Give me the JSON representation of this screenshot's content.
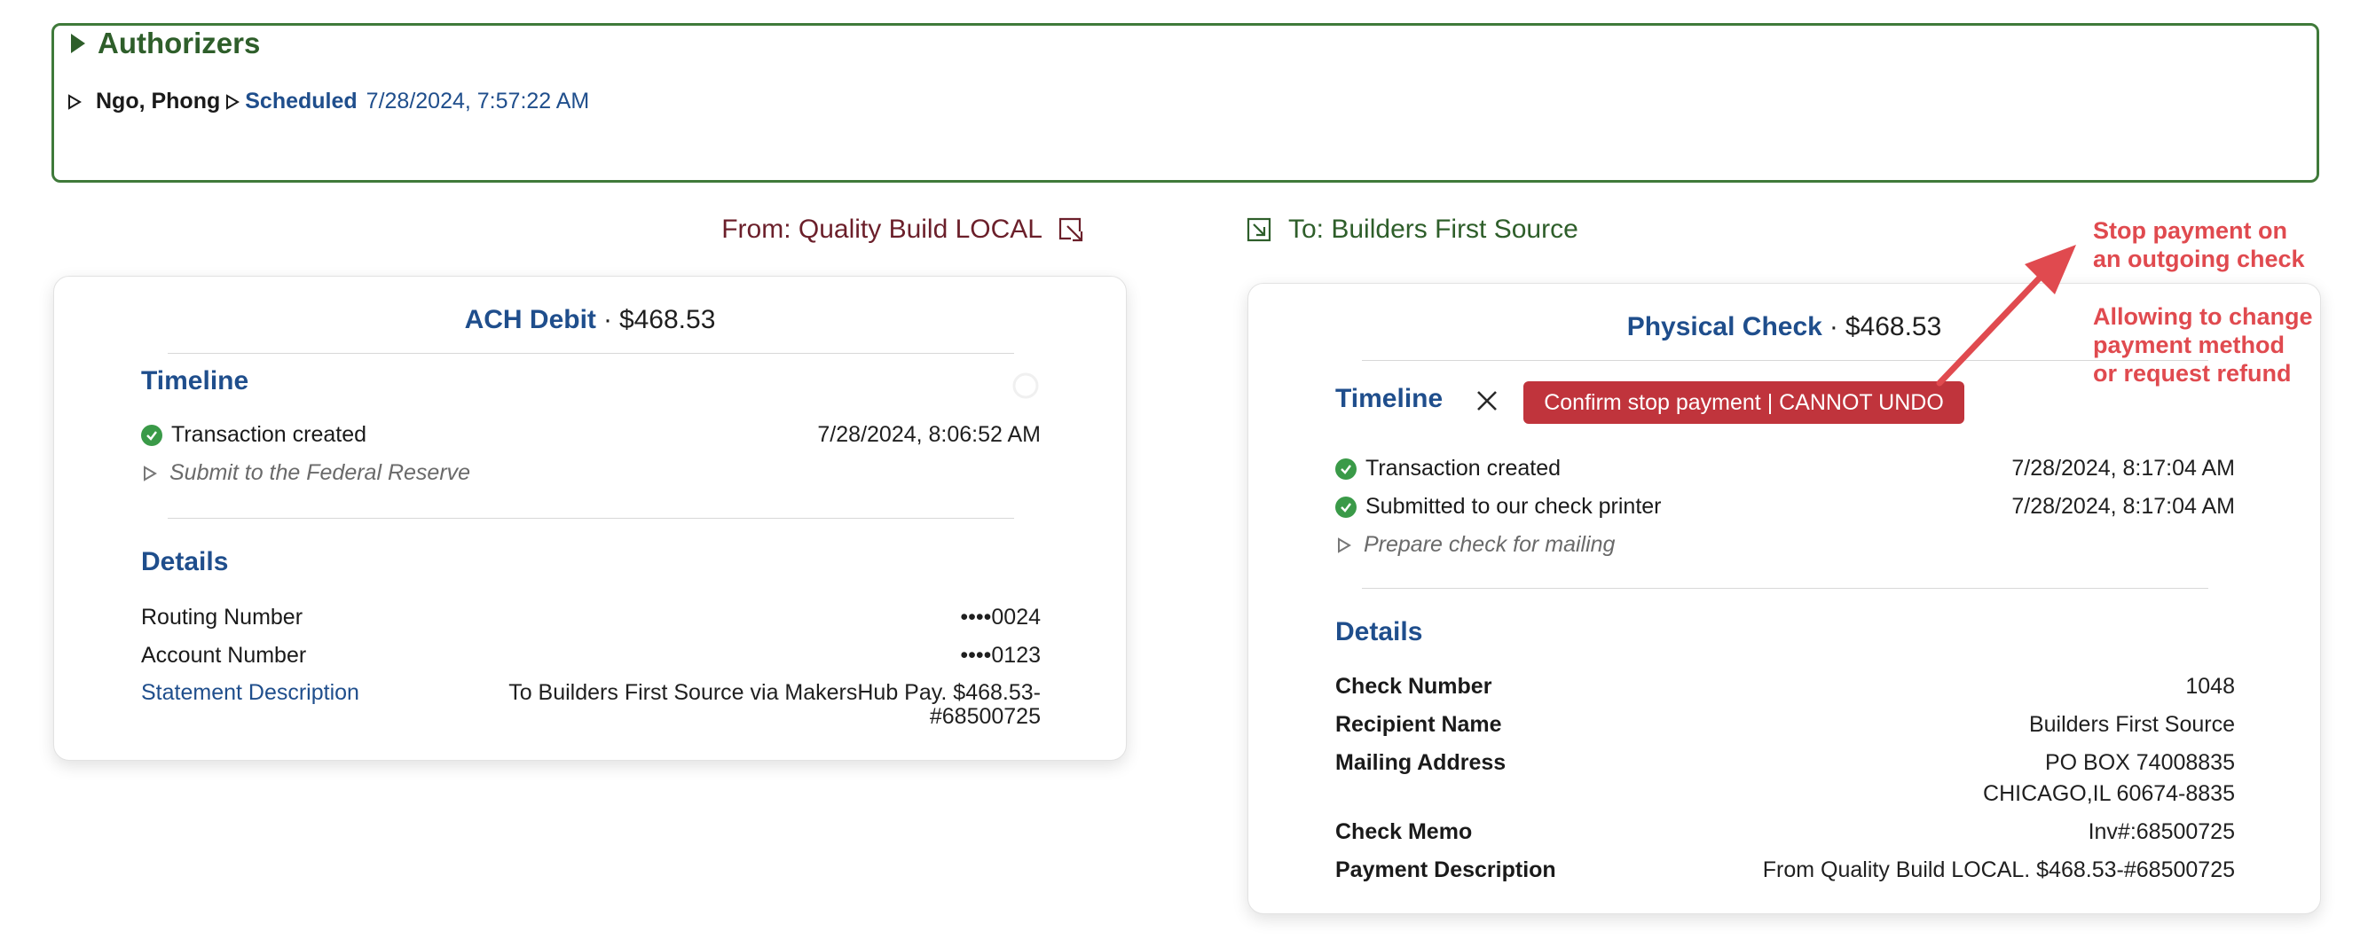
{
  "authorizers": {
    "title": "Authorizers",
    "entry": {
      "name": "Ngo, Phong",
      "status": "Scheduled",
      "time": "7/28/2024, 7:57:22 AM"
    }
  },
  "from": {
    "label": "From: Quality Build LOCAL"
  },
  "to": {
    "label": "To: Builders First Source"
  },
  "left_card": {
    "method": "ACH Debit",
    "amount": "$468.53",
    "timeline_title": "Timeline",
    "timeline": [
      {
        "text": "Transaction created",
        "time": "7/28/2024, 8:06:52 AM",
        "done": true
      },
      {
        "text": "Submit to the Federal Reserve",
        "time": "",
        "done": false
      }
    ],
    "details_title": "Details",
    "details": [
      {
        "label": "Routing Number",
        "value": "••••0024"
      },
      {
        "label": "Account Number",
        "value": "••••0123"
      },
      {
        "label": "Statement Description",
        "value": "To Builders First Source via MakersHub Pay. $468.53-",
        "value2": "#68500725"
      }
    ]
  },
  "right_card": {
    "method": "Physical Check",
    "amount": "$468.53",
    "timeline_title": "Timeline",
    "stop_button": "Confirm stop payment | CANNOT UNDO",
    "timeline": [
      {
        "text": "Transaction created",
        "time": "7/28/2024, 8:17:04 AM",
        "done": true
      },
      {
        "text": "Submitted to our check printer",
        "time": "7/28/2024, 8:17:04 AM",
        "done": true
      },
      {
        "text": "Prepare check for mailing",
        "time": "",
        "done": false
      }
    ],
    "details_title": "Details",
    "details": [
      {
        "label": "Check Number",
        "value": "1048"
      },
      {
        "label": "Recipient Name",
        "value": "Builders First Source"
      },
      {
        "label": "Mailing Address",
        "value": "PO BOX 74008835",
        "value2": "CHICAGO,IL 60674-8835"
      },
      {
        "label": "Check Memo",
        "value": "Inv#:68500725"
      },
      {
        "label": "Payment Description",
        "value": "From Quality Build LOCAL. $468.53-#68500725"
      }
    ]
  },
  "annotations": {
    "stop_line1": "Stop payment on",
    "stop_line2": "an outgoing check",
    "change_line1": "Allowing to change",
    "change_line2": "payment method",
    "change_line3": "or request refund"
  },
  "colors": {
    "green_border": "#3f7a3a",
    "blue": "#1f4e8c",
    "maroon": "#6b1f2a",
    "danger": "#c0343c",
    "annotation": "#e04a4f",
    "success": "#3a9a48"
  }
}
